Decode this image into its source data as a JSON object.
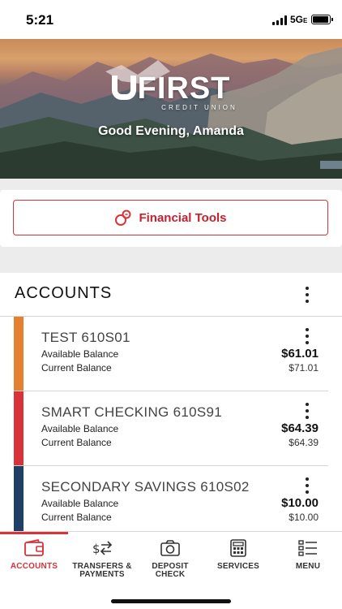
{
  "status_bar": {
    "time": "5:21",
    "network": "5G",
    "network_suffix": "E"
  },
  "hero": {
    "logo_main": "FIRST",
    "logo_sub": "CREDIT UNION",
    "greeting": "Good Evening, Amanda"
  },
  "tools": {
    "label": "Financial Tools"
  },
  "accounts": {
    "title": "ACCOUNTS",
    "available_label": "Available Balance",
    "current_label": "Current Balance",
    "items": [
      {
        "name": "TEST 610S01",
        "available": "$61.01",
        "current": "$71.01",
        "color": "#e38131"
      },
      {
        "name": "SMART CHECKING 610S91",
        "available": "$64.39",
        "current": "$64.39",
        "color": "#d8323a"
      },
      {
        "name": "SECONDARY SAVINGS 610S02",
        "available": "$10.00",
        "current": "$10.00",
        "color": "#1f3f66"
      }
    ]
  },
  "nav": {
    "accounts": "ACCOUNTS",
    "transfers_1": "TRANSFERS &",
    "transfers_2": "PAYMENTS",
    "deposit_1": "DEPOSIT",
    "deposit_2": "CHECK",
    "services": "SERVICES",
    "menu": "MENU"
  },
  "colors": {
    "accent": "#d8323a",
    "orange": "#e38131",
    "navy": "#1f3f66"
  }
}
